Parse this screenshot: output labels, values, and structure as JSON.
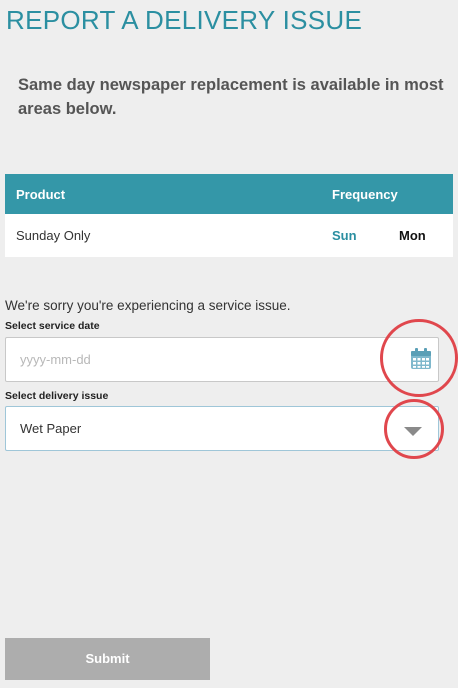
{
  "page": {
    "title": "REPORT A DELIVERY ISSUE",
    "notice": "Same day newspaper replacement is available in most areas below."
  },
  "table": {
    "headers": {
      "product": "Product",
      "frequency": "Frequency"
    },
    "rows": [
      {
        "product": "Sunday Only",
        "days": [
          "Sun",
          "Mon"
        ]
      }
    ]
  },
  "form": {
    "sorry_text": "We're sorry you're experiencing a service issue.",
    "service_date": {
      "label": "Select service date",
      "placeholder": "yyyy-mm-dd",
      "value": ""
    },
    "delivery_issue": {
      "label": "Select delivery issue",
      "selected": "Wet Paper"
    },
    "submit_label": "Submit"
  },
  "icons": {
    "date_picker": "calendar-icon",
    "dropdown": "dropdown-arrow-icon"
  },
  "colors": {
    "accent": "#2b8fa1",
    "table_header": "#3497a8",
    "highlight_circle": "#e0474d",
    "submit_disabled": "#adadad"
  }
}
